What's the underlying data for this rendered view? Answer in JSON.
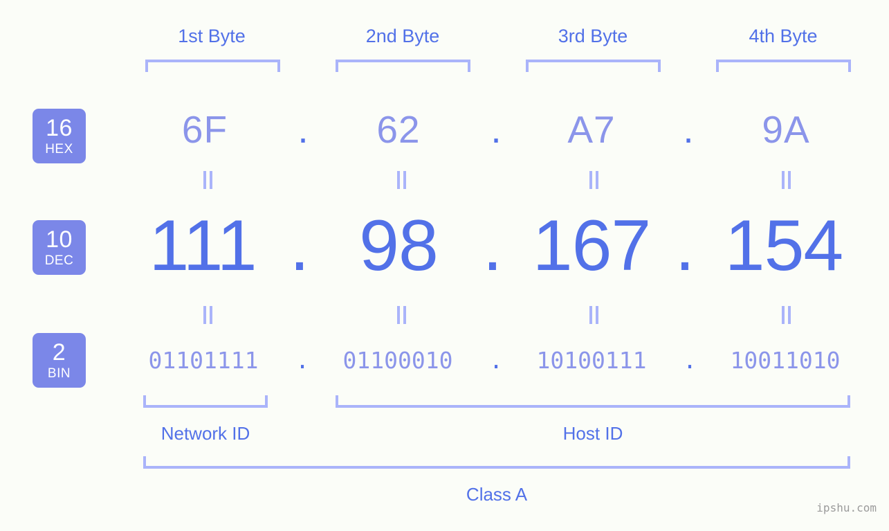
{
  "meta": {
    "background_color": "#fbfdf8",
    "accent_blue": "#5271e8",
    "accent_light": "#8b95ea",
    "bracket_color": "#aab4fa",
    "badge_color": "#7b87e8",
    "watermark": "ipshu.com"
  },
  "byte_headers": [
    {
      "label": "1st Byte"
    },
    {
      "label": "2nd Byte"
    },
    {
      "label": "3rd Byte"
    },
    {
      "label": "4th Byte"
    }
  ],
  "bases": [
    {
      "number": "16",
      "name": "HEX"
    },
    {
      "number": "10",
      "name": "DEC"
    },
    {
      "number": "2",
      "name": "BIN"
    }
  ],
  "rows": {
    "hex": {
      "values": [
        "6F",
        "62",
        "A7",
        "9A"
      ],
      "separator": "."
    },
    "dec": {
      "values": [
        "111",
        "98",
        "167",
        "154"
      ],
      "separator": "."
    },
    "bin": {
      "values": [
        "01101111",
        "01100010",
        "10100111",
        "10011010"
      ],
      "separator": "."
    }
  },
  "equivalence_symbol": "=",
  "sections": [
    {
      "label": "Network ID"
    },
    {
      "label": "Host ID"
    }
  ],
  "class": {
    "label": "Class A"
  }
}
